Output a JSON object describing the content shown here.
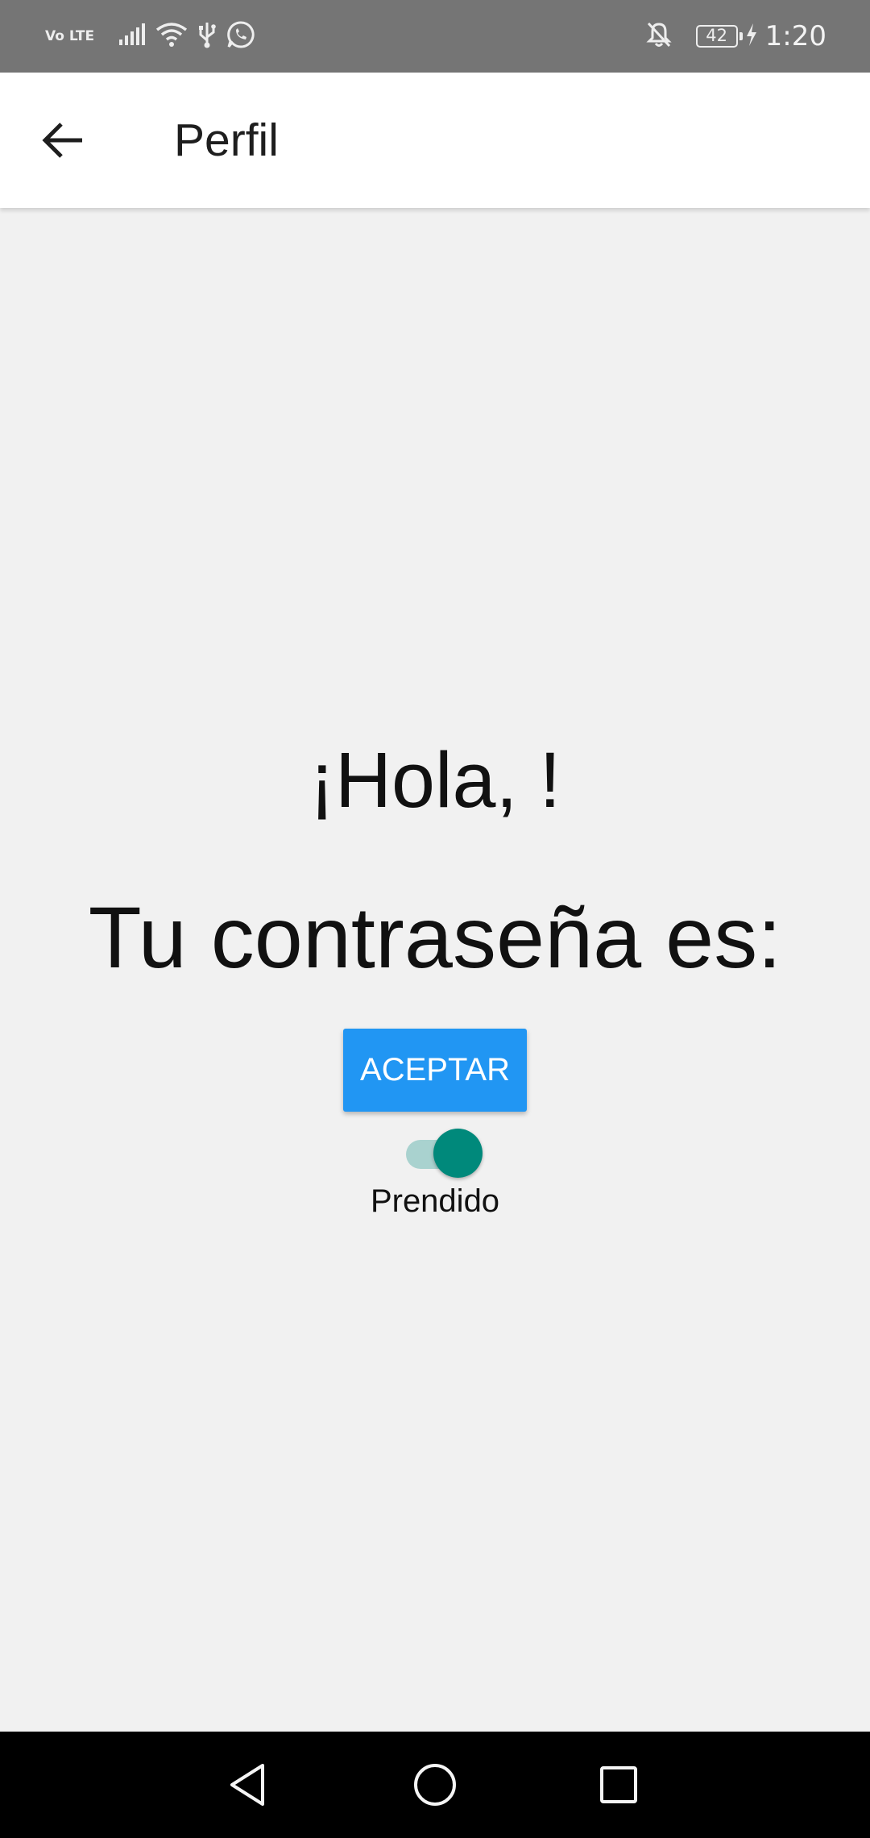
{
  "status_bar": {
    "network_label": "Vo LTE",
    "battery_level": "42",
    "time": "1:20",
    "icons": [
      "volte-icon",
      "signal-icon",
      "wifi-icon",
      "usb-icon",
      "whatsapp-icon",
      "notifications-off-icon",
      "battery-icon",
      "charging-icon"
    ]
  },
  "app_bar": {
    "back_icon": "arrow-back-icon",
    "title": "Perfil"
  },
  "main": {
    "greeting": "¡Hola, !",
    "password_label": "Tu contraseña es:",
    "accept_button": "ACEPTAR",
    "switch_on": true,
    "switch_label": "Prendido"
  },
  "nav_bar": {
    "icons": [
      "back-triangle-icon",
      "home-circle-icon",
      "recents-square-icon"
    ]
  },
  "colors": {
    "status_bar": "#757575",
    "background": "#f1f1f1",
    "button": "#2196f3",
    "switch_thumb": "#00897b",
    "switch_track": "#a9d2cf"
  }
}
